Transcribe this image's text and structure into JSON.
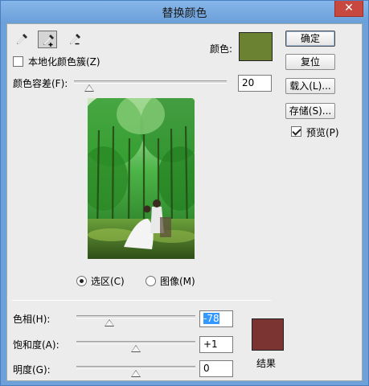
{
  "window": {
    "title": "替换颜色",
    "close_symbol": "✕"
  },
  "tools": [
    {
      "name": "eyedropper",
      "active": false
    },
    {
      "name": "eyedropper-plus",
      "active": true
    },
    {
      "name": "eyedropper-minus",
      "active": false
    }
  ],
  "localized_color_clusters": {
    "label": "本地化颜色簇(Z)",
    "checked": false
  },
  "selection_color": {
    "label": "颜色:",
    "hex": "#6b8232"
  },
  "fuzziness": {
    "label": "颜色容差(F):",
    "value": "20",
    "slider_fraction": 0.1
  },
  "view_mode": {
    "selection_label": "选区(C)",
    "image_label": "图像(M)",
    "selected": "selection"
  },
  "buttons": {
    "ok": "确定",
    "reset": "复位",
    "load": "载入(L)...",
    "save": "存储(S)..."
  },
  "preview_option": {
    "label": "预览(P)",
    "checked": true
  },
  "hue": {
    "label": "色相(H):",
    "value": "-78",
    "slider_fraction": 0.28
  },
  "saturation": {
    "label": "饱和度(A):",
    "value": "+1",
    "slider_fraction": 0.5
  },
  "lightness": {
    "label": "明度(G):",
    "value": "0",
    "slider_fraction": 0.5
  },
  "result": {
    "label": "结果",
    "hex": "#7b3432"
  }
}
